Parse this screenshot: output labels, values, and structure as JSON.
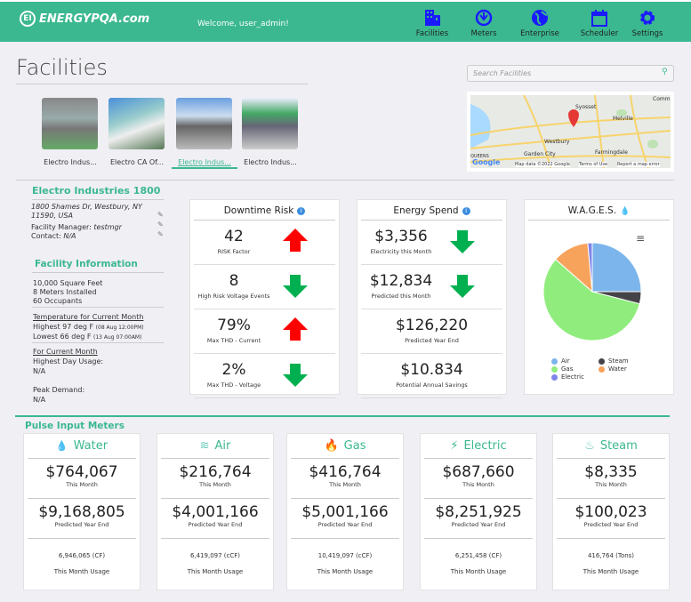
{
  "header": {
    "logo": "ENERGYPQA.com",
    "welcome": "Welcome, user_admin!",
    "nav": [
      {
        "label": "Facilities",
        "icon": "building-icon"
      },
      {
        "label": "Meters",
        "icon": "meter-icon"
      },
      {
        "label": "Enterprise",
        "icon": "globe-icon"
      },
      {
        "label": "Scheduler",
        "icon": "calendar-icon"
      },
      {
        "label": "Settings",
        "icon": "gear-icon"
      }
    ]
  },
  "page": {
    "title": "Facilities",
    "search_placeholder": "Search Facilities"
  },
  "facilities": [
    {
      "label": "Electro Indus...",
      "active": false
    },
    {
      "label": "Electro CA Of...",
      "active": false
    },
    {
      "label": "Electro Indus...",
      "active": true
    },
    {
      "label": "Electro Indus...",
      "active": false
    }
  ],
  "map": {
    "labels": [
      "Syosset",
      "Melville",
      "Westbury",
      "Garden City",
      "Farmingdale",
      "QUEENS",
      "Comm"
    ],
    "attribution": "Map data ©2022 Google",
    "terms": "Terms of Use",
    "report": "Report a map error",
    "google": "Google"
  },
  "facility": {
    "name": "Electro Industries 1800",
    "address": "1800 Shames Dr, Westbury, NY 11590, USA",
    "manager_label": "Facility Manager:",
    "manager": "testmgr",
    "contact_label": "Contact:",
    "contact": "N/A",
    "info_title": "Facility Information",
    "sqft": "10,000 Square Feet",
    "meters": "8 Meters Installed",
    "occupants": "60 Occupants",
    "temp_title": "Temperature for Current Month",
    "temp_high": "Highest 97 deg F",
    "temp_high_when": "(08 Aug 12:00PM)",
    "temp_low": "Lowest 66 deg F",
    "temp_low_when": "(13 Aug 07:00AM)",
    "month_title": "For Current Month",
    "highest_day_label": "Highest Day Usage:",
    "highest_day": "N/A",
    "peak_label": "Peak Demand:",
    "peak": "N/A"
  },
  "downtime": {
    "title": "Downtime Risk",
    "rows": [
      {
        "value": "42",
        "label": "RISK Factor",
        "trend": "up"
      },
      {
        "value": "8",
        "label": "High Risk Voltage Events",
        "trend": "down"
      },
      {
        "value": "79%",
        "label": "Max THD - Current",
        "trend": "up"
      },
      {
        "value": "2%",
        "label": "Max THD - Voltage",
        "trend": "down"
      }
    ]
  },
  "spend": {
    "title": "Energy Spend",
    "rows": [
      {
        "value": "$3,356",
        "label": "Electricity this Month",
        "trend": "down"
      },
      {
        "value": "$12,834",
        "label": "Predicted this Month",
        "trend": "down"
      },
      {
        "value": "$126,220",
        "label": "Predicted Year End",
        "trend": ""
      },
      {
        "value": "$10.834",
        "label": "Potential Annual Savings",
        "trend": ""
      }
    ]
  },
  "chart_data": {
    "type": "pie",
    "title": "W.A.G.E.S.",
    "legend": "bottom",
    "slices": [
      {
        "name": "Air",
        "value": 25,
        "color": "#7cb5ec"
      },
      {
        "name": "Steam",
        "value": 4,
        "color": "#434348"
      },
      {
        "name": "Gas",
        "value": 57.5,
        "color": "#90ed7d"
      },
      {
        "name": "Water",
        "value": 12,
        "color": "#f7a35c"
      },
      {
        "name": "Electric",
        "value": 1.5,
        "color": "#8085e9"
      }
    ]
  },
  "pulse": {
    "title": "Pulse Input Meters",
    "meters": [
      {
        "name": "Water",
        "icon": "water-drop-icon",
        "month": "$764,067",
        "month_label": "This Month",
        "year": "$9,168,805",
        "year_label": "Predicted Year End",
        "usage": "6,946,065 (CF)",
        "usage_label": "This Month Usage"
      },
      {
        "name": "Air",
        "icon": "wind-icon",
        "month": "$216,764",
        "month_label": "This Month",
        "year": "$4,001,166",
        "year_label": "Predicted Year End",
        "usage": "6,419,097 (cCF)",
        "usage_label": "This Month Usage"
      },
      {
        "name": "Gas",
        "icon": "flame-icon",
        "month": "$416,764",
        "month_label": "This Month",
        "year": "$5,001,166",
        "year_label": "Predicted Year End",
        "usage": "10,419,097 (cCF)",
        "usage_label": "This Month Usage"
      },
      {
        "name": "Electric",
        "icon": "lightning-icon",
        "month": "$687,660",
        "month_label": "This Month",
        "year": "$8,251,925",
        "year_label": "Predicted Year End",
        "usage": "6,251,458 (CF)",
        "usage_label": "This Month Usage"
      },
      {
        "name": "Steam",
        "icon": "steam-icon",
        "month": "$8,335",
        "month_label": "This Month",
        "year": "$100,023",
        "year_label": "Predicted Year End",
        "usage": "416,764 (Tons)",
        "usage_label": "This Month Usage"
      }
    ]
  },
  "colors": {
    "brand": "#3bb88f",
    "nav_icon": "#1a1aff",
    "up": "#ff0000",
    "down": "#00b050"
  }
}
